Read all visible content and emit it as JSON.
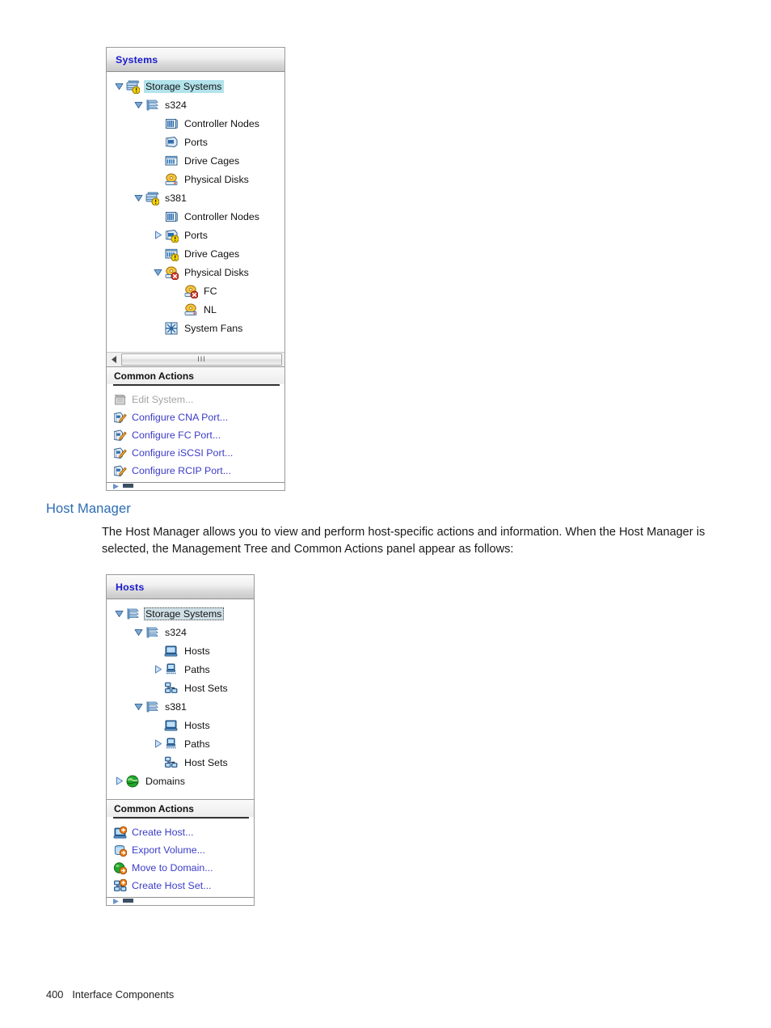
{
  "page": {
    "footer_number": "400",
    "footer_title": "Interface Components"
  },
  "section": {
    "heading": "Host Manager",
    "paragraph": "The Host Manager allows you to view and perform host-specific actions and information. When the Host Manager is selected, the Management Tree and Common Actions panel appear as follows:"
  },
  "colors": {
    "heading_blue": "#2b6cb5",
    "panel_title_blue": "#1919cc",
    "link_blue": "#3c3cc8",
    "selection_cyan": "#b3e3ec",
    "focus_gray_blue": "#cfdfe6",
    "disabled_gray": "#a3a3a3"
  },
  "systems_panel": {
    "header_title": "Systems",
    "tree": [
      {
        "label": "Storage Systems",
        "depth": 0,
        "twisty": "expanded",
        "icon": "storage-systems-warning-icon",
        "state": "selected"
      },
      {
        "label": "s324",
        "depth": 1,
        "twisty": "expanded",
        "icon": "system-icon",
        "state": "normal"
      },
      {
        "label": "Controller Nodes",
        "depth": 2,
        "twisty": "none",
        "icon": "controller-nodes-icon",
        "state": "normal"
      },
      {
        "label": "Ports",
        "depth": 2,
        "twisty": "none",
        "icon": "ports-icon",
        "state": "normal"
      },
      {
        "label": "Drive Cages",
        "depth": 2,
        "twisty": "none",
        "icon": "drive-cages-icon",
        "state": "normal"
      },
      {
        "label": "Physical Disks",
        "depth": 2,
        "twisty": "none",
        "icon": "physical-disks-icon",
        "state": "normal"
      },
      {
        "label": "s381",
        "depth": 1,
        "twisty": "expanded",
        "icon": "system-warning-icon",
        "state": "normal"
      },
      {
        "label": "Controller Nodes",
        "depth": 2,
        "twisty": "none",
        "icon": "controller-nodes-icon",
        "state": "normal"
      },
      {
        "label": "Ports",
        "depth": 2,
        "twisty": "collapsed",
        "icon": "ports-warning-icon",
        "state": "normal"
      },
      {
        "label": "Drive Cages",
        "depth": 2,
        "twisty": "none",
        "icon": "drive-cages-warning-icon",
        "state": "normal"
      },
      {
        "label": "Physical Disks",
        "depth": 2,
        "twisty": "expanded",
        "icon": "physical-disks-error-icon",
        "state": "normal"
      },
      {
        "label": "FC",
        "depth": 3,
        "twisty": "none",
        "icon": "physical-disks-error-icon",
        "state": "normal"
      },
      {
        "label": "NL",
        "depth": 3,
        "twisty": "none",
        "icon": "physical-disks-icon",
        "state": "normal"
      },
      {
        "label": "System Fans",
        "depth": 2,
        "twisty": "none",
        "icon": "system-fans-icon",
        "state": "normal"
      }
    ],
    "scrollbar": {
      "left_arrow": "scroll-left-arrow",
      "grip": "III"
    },
    "common_actions": {
      "title": "Common Actions",
      "items": [
        {
          "label": "Edit System...",
          "icon": "edit-system-icon",
          "disabled": true
        },
        {
          "label": "Configure CNA Port...",
          "icon": "configure-port-icon",
          "disabled": false
        },
        {
          "label": "Configure FC Port...",
          "icon": "configure-port-icon",
          "disabled": false
        },
        {
          "label": "Configure iSCSI Port...",
          "icon": "configure-port-icon",
          "disabled": false
        },
        {
          "label": "Configure RCIP Port...",
          "icon": "configure-port-icon",
          "disabled": false
        }
      ]
    }
  },
  "hosts_panel": {
    "header_title": "Hosts",
    "tree": [
      {
        "label": "Storage Systems",
        "depth": 0,
        "twisty": "expanded",
        "icon": "system-icon",
        "state": "focused"
      },
      {
        "label": "s324",
        "depth": 1,
        "twisty": "expanded",
        "icon": "system-icon",
        "state": "normal"
      },
      {
        "label": "Hosts",
        "depth": 2,
        "twisty": "none",
        "icon": "host-icon",
        "state": "normal"
      },
      {
        "label": "Paths",
        "depth": 2,
        "twisty": "collapsed",
        "icon": "paths-icon",
        "state": "normal"
      },
      {
        "label": "Host Sets",
        "depth": 2,
        "twisty": "none",
        "icon": "host-sets-icon",
        "state": "normal"
      },
      {
        "label": "s381",
        "depth": 1,
        "twisty": "expanded",
        "icon": "system-icon",
        "state": "normal"
      },
      {
        "label": "Hosts",
        "depth": 2,
        "twisty": "none",
        "icon": "host-icon",
        "state": "normal"
      },
      {
        "label": "Paths",
        "depth": 2,
        "twisty": "collapsed",
        "icon": "paths-icon",
        "state": "normal"
      },
      {
        "label": "Host Sets",
        "depth": 2,
        "twisty": "none",
        "icon": "host-sets-icon",
        "state": "normal"
      },
      {
        "label": "Domains",
        "depth": 0,
        "twisty": "collapsed",
        "icon": "domains-icon",
        "state": "normal"
      }
    ],
    "common_actions": {
      "title": "Common Actions",
      "items": [
        {
          "label": "Create Host...",
          "icon": "create-host-icon",
          "disabled": false
        },
        {
          "label": "Export Volume...",
          "icon": "export-volume-icon",
          "disabled": false
        },
        {
          "label": "Move to Domain...",
          "icon": "move-to-domain-icon",
          "disabled": false
        },
        {
          "label": "Create Host Set...",
          "icon": "create-host-set-icon",
          "disabled": false
        }
      ]
    }
  }
}
